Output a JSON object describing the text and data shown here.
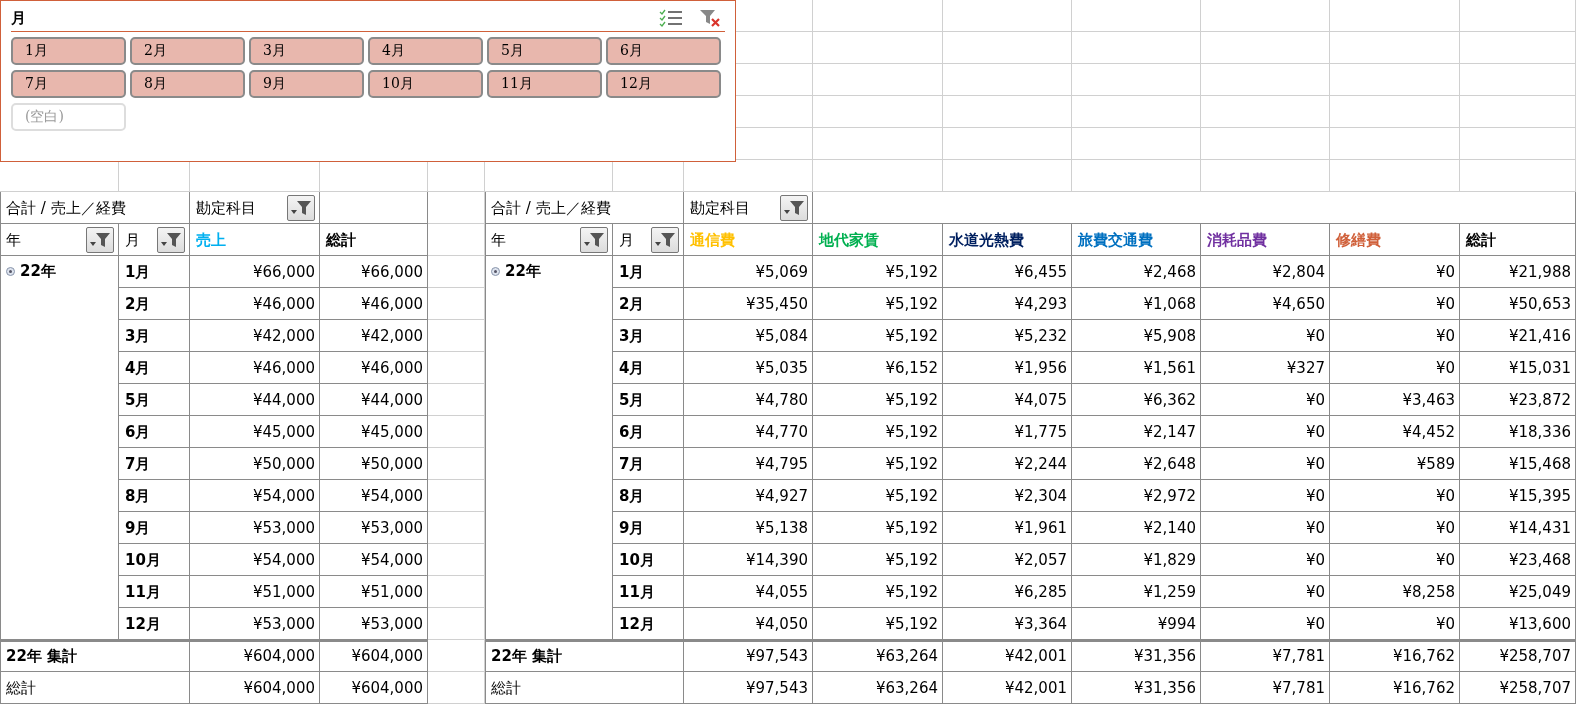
{
  "slicer": {
    "title": "月",
    "items": [
      {
        "label": "1月",
        "selected": true
      },
      {
        "label": "2月",
        "selected": true
      },
      {
        "label": "3月",
        "selected": true
      },
      {
        "label": "4月",
        "selected": true
      },
      {
        "label": "5月",
        "selected": true
      },
      {
        "label": "6月",
        "selected": true
      },
      {
        "label": "7月",
        "selected": true
      },
      {
        "label": "8月",
        "selected": true
      },
      {
        "label": "9月",
        "selected": true
      },
      {
        "label": "10月",
        "selected": true
      },
      {
        "label": "11月",
        "selected": true
      },
      {
        "label": "12月",
        "selected": true
      },
      {
        "label": "(空白)",
        "selected": false
      }
    ]
  },
  "pivots": [
    {
      "corner_label": "合計 / 売上／経費",
      "column_field": "勘定科目",
      "row_fields": [
        "年",
        "月"
      ],
      "grand_total_header": "総計",
      "year": "22年",
      "columns": [
        {
          "label": "売上",
          "color": "#00b0f0"
        }
      ],
      "rows": [
        {
          "month": "1月",
          "values": [
            "¥66,000"
          ],
          "total": "¥66,000"
        },
        {
          "month": "2月",
          "values": [
            "¥46,000"
          ],
          "total": "¥46,000"
        },
        {
          "month": "3月",
          "values": [
            "¥42,000"
          ],
          "total": "¥42,000"
        },
        {
          "month": "4月",
          "values": [
            "¥46,000"
          ],
          "total": "¥46,000"
        },
        {
          "month": "5月",
          "values": [
            "¥44,000"
          ],
          "total": "¥44,000"
        },
        {
          "month": "6月",
          "values": [
            "¥45,000"
          ],
          "total": "¥45,000"
        },
        {
          "month": "7月",
          "values": [
            "¥50,000"
          ],
          "total": "¥50,000"
        },
        {
          "month": "8月",
          "values": [
            "¥54,000"
          ],
          "total": "¥54,000"
        },
        {
          "month": "9月",
          "values": [
            "¥53,000"
          ],
          "total": "¥53,000"
        },
        {
          "month": "10月",
          "values": [
            "¥54,000"
          ],
          "total": "¥54,000"
        },
        {
          "month": "11月",
          "values": [
            "¥51,000"
          ],
          "total": "¥51,000"
        },
        {
          "month": "12月",
          "values": [
            "¥53,000"
          ],
          "total": "¥53,000"
        }
      ],
      "subtotal": {
        "label": "22年 集計",
        "values": [
          "¥604,000"
        ],
        "total": "¥604,000"
      },
      "grand_total": {
        "label": "総計",
        "values": [
          "¥604,000"
        ],
        "total": "¥604,000"
      }
    },
    {
      "corner_label": "合計 / 売上／経費",
      "column_field": "勘定科目",
      "row_fields": [
        "年",
        "月"
      ],
      "grand_total_header": "総計",
      "year": "22年",
      "columns": [
        {
          "label": "通信費",
          "color": "#ffc000"
        },
        {
          "label": "地代家賃",
          "color": "#00b050"
        },
        {
          "label": "水道光熱費",
          "color": "#002060"
        },
        {
          "label": "旅費交通費",
          "color": "#0070c0"
        },
        {
          "label": "消耗品費",
          "color": "#7030a0"
        },
        {
          "label": "修繕費",
          "color": "#d0603a"
        }
      ],
      "rows": [
        {
          "month": "1月",
          "values": [
            "¥5,069",
            "¥5,192",
            "¥6,455",
            "¥2,468",
            "¥2,804",
            "¥0"
          ],
          "total": "¥21,988"
        },
        {
          "month": "2月",
          "values": [
            "¥35,450",
            "¥5,192",
            "¥4,293",
            "¥1,068",
            "¥4,650",
            "¥0"
          ],
          "total": "¥50,653"
        },
        {
          "month": "3月",
          "values": [
            "¥5,084",
            "¥5,192",
            "¥5,232",
            "¥5,908",
            "¥0",
            "¥0"
          ],
          "total": "¥21,416"
        },
        {
          "month": "4月",
          "values": [
            "¥5,035",
            "¥6,152",
            "¥1,956",
            "¥1,561",
            "¥327",
            "¥0"
          ],
          "total": "¥15,031"
        },
        {
          "month": "5月",
          "values": [
            "¥4,780",
            "¥5,192",
            "¥4,075",
            "¥6,362",
            "¥0",
            "¥3,463"
          ],
          "total": "¥23,872"
        },
        {
          "month": "6月",
          "values": [
            "¥4,770",
            "¥5,192",
            "¥1,775",
            "¥2,147",
            "¥0",
            "¥4,452"
          ],
          "total": "¥18,336"
        },
        {
          "month": "7月",
          "values": [
            "¥4,795",
            "¥5,192",
            "¥2,244",
            "¥2,648",
            "¥0",
            "¥589"
          ],
          "total": "¥15,468"
        },
        {
          "month": "8月",
          "values": [
            "¥4,927",
            "¥5,192",
            "¥2,304",
            "¥2,972",
            "¥0",
            "¥0"
          ],
          "total": "¥15,395"
        },
        {
          "month": "9月",
          "values": [
            "¥5,138",
            "¥5,192",
            "¥1,961",
            "¥2,140",
            "¥0",
            "¥0"
          ],
          "total": "¥14,431"
        },
        {
          "month": "10月",
          "values": [
            "¥14,390",
            "¥5,192",
            "¥2,057",
            "¥1,829",
            "¥0",
            "¥0"
          ],
          "total": "¥23,468"
        },
        {
          "month": "11月",
          "values": [
            "¥4,055",
            "¥5,192",
            "¥6,285",
            "¥1,259",
            "¥0",
            "¥8,258"
          ],
          "total": "¥25,049"
        },
        {
          "month": "12月",
          "values": [
            "¥4,050",
            "¥5,192",
            "¥3,364",
            "¥994",
            "¥0",
            "¥0"
          ],
          "total": "¥13,600"
        }
      ],
      "subtotal": {
        "label": "22年 集計",
        "values": [
          "¥97,543",
          "¥63,264",
          "¥42,001",
          "¥31,356",
          "¥7,781",
          "¥16,762"
        ],
        "total": "¥258,707"
      },
      "grand_total": {
        "label": "総計",
        "values": [
          "¥97,543",
          "¥63,264",
          "¥42,001",
          "¥31,356",
          "¥7,781",
          "¥16,762"
        ],
        "total": "¥258,707"
      }
    }
  ]
}
